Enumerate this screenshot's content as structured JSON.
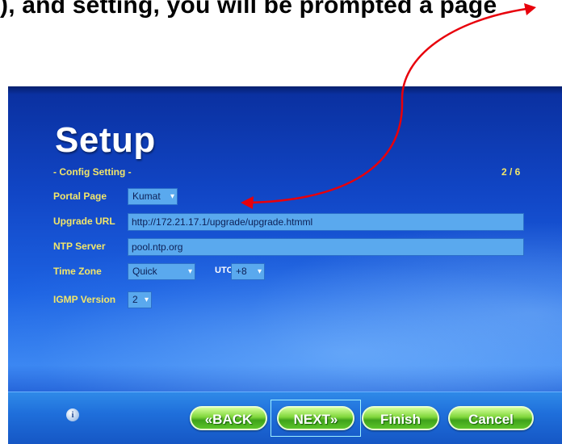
{
  "caption": "), and setting, you will be prompted a page",
  "setup": {
    "title": "Setup",
    "subtitle": "- Config Setting -",
    "page_counter": "2 / 6",
    "rows": {
      "portal_page": {
        "label": "Portal Page",
        "value": "Kumat"
      },
      "upgrade_url": {
        "label": "Upgrade URL",
        "value": "http://172.21.17.1/upgrade/upgrade.htmml"
      },
      "ntp_server": {
        "label": "NTP Server",
        "value": "pool.ntp.org"
      },
      "time_zone": {
        "label": "Time Zone",
        "value": "Quick",
        "utc_label": "UTC",
        "utc_offset": "+8"
      },
      "igmp_version": {
        "label": "IGMP Version",
        "value": "2"
      }
    },
    "buttons": {
      "back": "«BACK",
      "next": "NEXT»",
      "finish": "Finish",
      "cancel": "Cancel"
    }
  },
  "colors": {
    "arrow": "#e8000b",
    "label_yellow": "#f2e66a",
    "field_blue": "#5aa9ee",
    "button_green": "#5cc52a"
  },
  "icons": {
    "dropdown": "chevron-down-icon",
    "info": "info-icon",
    "annotation": "red-arrow-icon"
  }
}
